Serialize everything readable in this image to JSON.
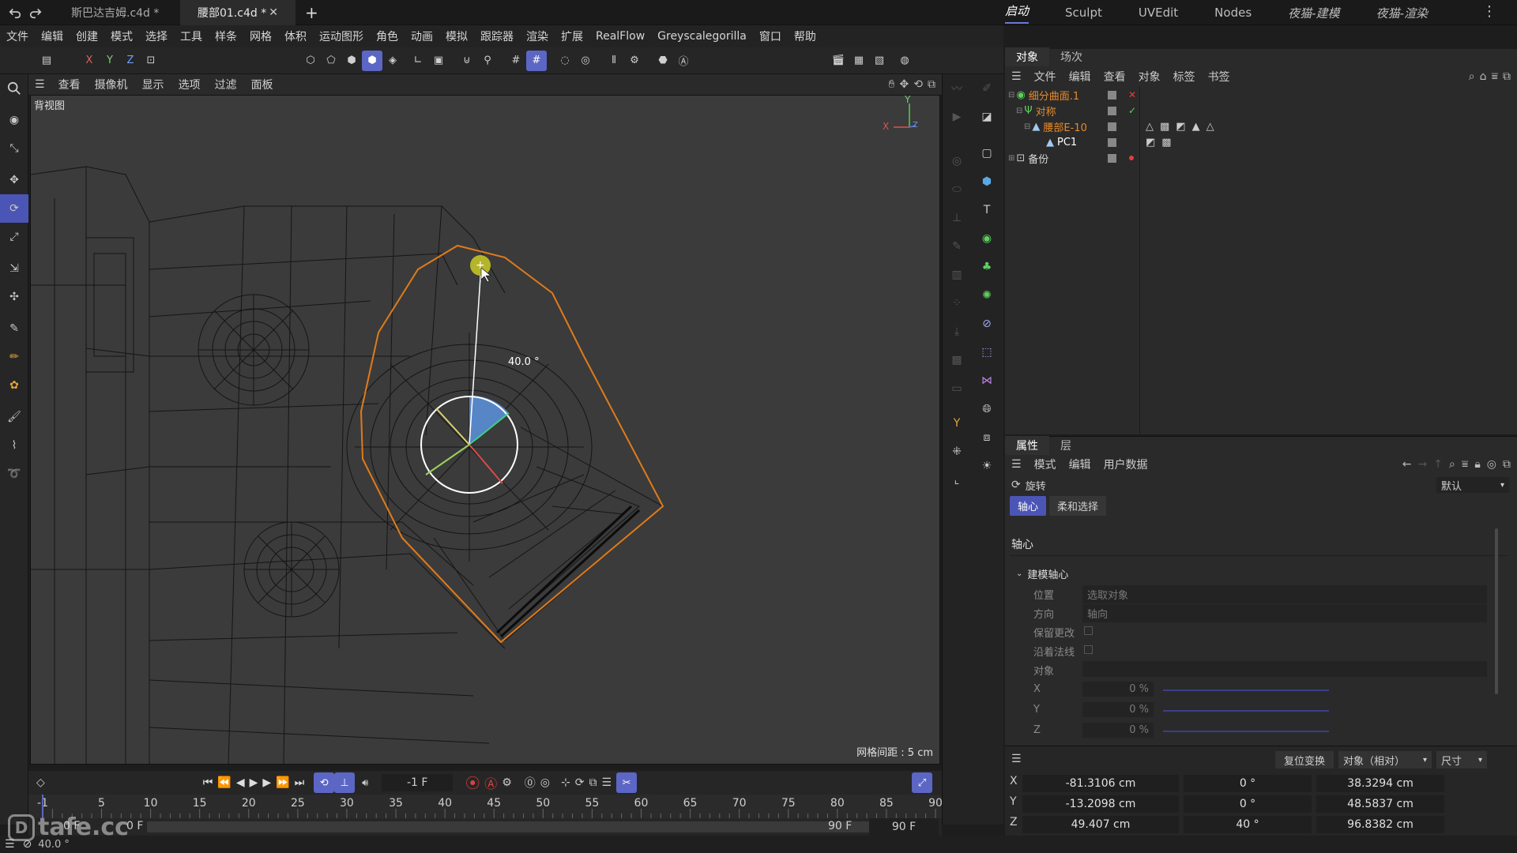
{
  "titlebar": {
    "tabs": [
      {
        "label": "斯巴达吉姆.c4d *",
        "active": false
      },
      {
        "label": "腰部01.c4d *",
        "active": true
      }
    ],
    "layouts": [
      "启动",
      "Sculpt",
      "UVEdit",
      "Nodes",
      "夜猫-建模",
      "夜猫-渲染"
    ],
    "active_layout": "启动"
  },
  "menubar": [
    "文件",
    "编辑",
    "创建",
    "模式",
    "选择",
    "工具",
    "样条",
    "网格",
    "体积",
    "运动图形",
    "角色",
    "动画",
    "模拟",
    "跟踪器",
    "渲染",
    "扩展",
    "RealFlow",
    "Greyscalegorilla",
    "窗口",
    "帮助"
  ],
  "toolbar": {
    "axis_x": "X",
    "axis_y": "Y",
    "axis_z": "Z"
  },
  "viewport": {
    "menu": [
      "查看",
      "摄像机",
      "显示",
      "选项",
      "过滤",
      "面板"
    ],
    "view_name": "背视图",
    "rotation_readout": "40.0 °",
    "grid_spacing": "网格间距 : 5 cm",
    "axis_labels": {
      "x": "X",
      "y": "Y",
      "z": "Z"
    }
  },
  "objects": {
    "tabs": [
      "对象",
      "场次"
    ],
    "menu": [
      "文件",
      "编辑",
      "查看",
      "对象",
      "标签",
      "书签"
    ],
    "rows": [
      {
        "name": "细分曲面.1",
        "color": "#e88a2a"
      },
      {
        "name": "对称",
        "color": "#e88a2a"
      },
      {
        "name": "腰部E-10",
        "color": "#e88a2a"
      },
      {
        "name": "PC1",
        "color": "#ffffff"
      },
      {
        "name": "备份",
        "color": "#d8d8d8"
      }
    ]
  },
  "attributes": {
    "tabs": [
      "属性",
      "层"
    ],
    "menu": [
      "模式",
      "编辑",
      "用户数据"
    ],
    "tool_name": "旋转",
    "preset": "默认",
    "subtabs": [
      "轴心",
      "柔和选择"
    ],
    "section": "轴心",
    "group": "建模轴心",
    "fields": {
      "position_label": "位置",
      "position_value": "选取对象",
      "orientation_label": "方向",
      "orientation_value": "轴向",
      "keep_changes_label": "保留更改",
      "along_normal_label": "沿着法线",
      "object_label": "对象",
      "x_label": "X",
      "x_value": "0 %",
      "y_label": "Y",
      "y_value": "0 %",
      "z_label": "Z",
      "z_value": "0 %"
    }
  },
  "coordinates": {
    "reset_button": "复位变换",
    "mode_select": "对象（相对）",
    "size_select": "尺寸",
    "rows": [
      {
        "axis": "X",
        "pos": "-81.3106 cm",
        "rot": "0 °",
        "size": "38.3294 cm"
      },
      {
        "axis": "Y",
        "pos": "-13.2098 cm",
        "rot": "0 °",
        "size": "48.5837 cm"
      },
      {
        "axis": "Z",
        "pos": "49.407 cm",
        "rot": "40 °",
        "size": "96.8382 cm"
      }
    ]
  },
  "timeline": {
    "current_frame": "-1 F",
    "ticks": [
      "-1",
      "5",
      "10",
      "15",
      "20",
      "25",
      "30",
      "35",
      "40",
      "45",
      "50",
      "55",
      "60",
      "65",
      "70",
      "75",
      "80",
      "85",
      "90"
    ],
    "start_a": "0 F",
    "start_b": "0 F",
    "end_a": "90 F",
    "end_b": "90 F"
  },
  "status": {
    "text": "40.0 °",
    "watermark": "tafe.cc"
  }
}
